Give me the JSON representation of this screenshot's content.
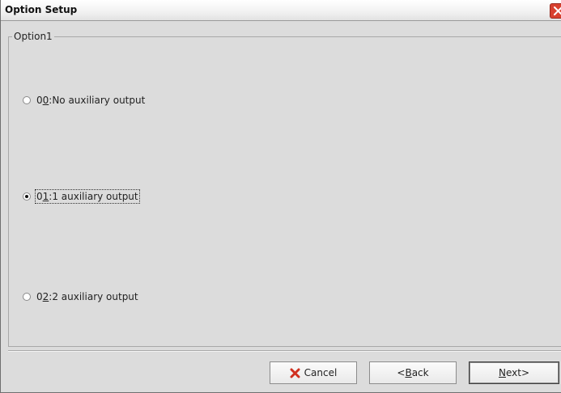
{
  "window": {
    "title": "Option Setup",
    "close_icon": "close-icon"
  },
  "group": {
    "label": "Option1"
  },
  "options": [
    {
      "label": "00:No auxiliary output",
      "mnemonic": "0",
      "selected": false
    },
    {
      "label": "01:1 auxiliary output",
      "mnemonic": "1",
      "selected": true
    },
    {
      "label": "02:2 auxiliary output",
      "mnemonic": "2",
      "selected": false
    }
  ],
  "buttons": {
    "cancel_label": "Cancel",
    "cancel_icon": "x-icon",
    "back_label": "<Back",
    "back_mnemonic": "B",
    "next_label": "Next>",
    "next_mnemonic": "N"
  },
  "colors": {
    "close_button": "#d8412f",
    "cancel_icon": "#d03020"
  }
}
